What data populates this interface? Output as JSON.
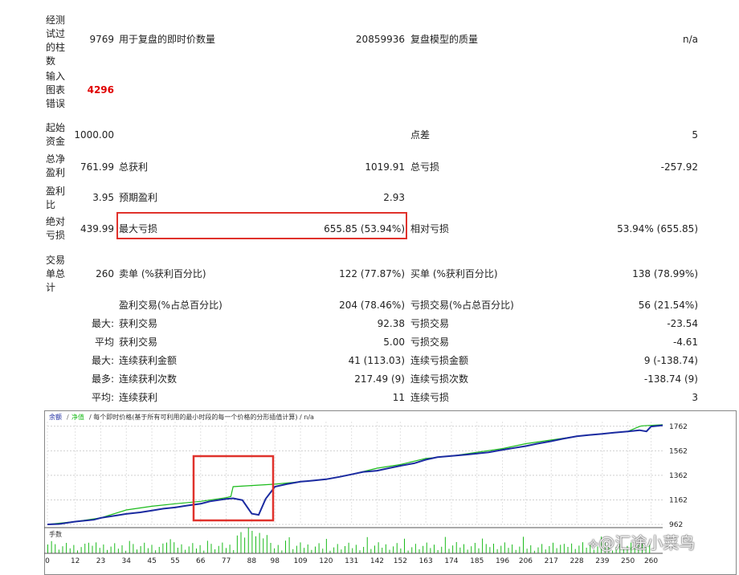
{
  "rows": [
    {
      "label": "经测试过的柱数",
      "v1": "9769",
      "l2": "用于复盘的即时价数量",
      "v2": "20859936",
      "l3": "复盘模型的质量",
      "v3": "n/a"
    },
    {
      "label": "输入图表错误",
      "v1": "4296"
    },
    {
      "label": "起始资金",
      "v1": "1000.00",
      "l3": "点差",
      "v3": "5"
    },
    {
      "label": "总净盈利",
      "v1": "761.99",
      "l2": "总获利",
      "v2": "1019.91",
      "l3": "总亏损",
      "v3": "-257.92"
    },
    {
      "label": "盈利比",
      "v1": "3.95",
      "l2": "预期盈利",
      "v2": "2.93"
    },
    {
      "label": "绝对亏损",
      "v1": "439.99",
      "l2": "最大亏损",
      "v2": "655.85 (53.94%)",
      "l3": "相对亏损",
      "v3": "53.94% (655.85)"
    },
    {
      "label": "交易单总计",
      "v1": "260",
      "l2": "卖单 (%获利百分比)",
      "v2": "122 (77.87%)",
      "l3": "买单 (%获利百分比)",
      "v3": "138 (78.99%)"
    }
  ],
  "sub_rows": [
    {
      "prefix": "",
      "l2": "盈利交易(%占总百分比)",
      "v2": "204 (78.46%)",
      "l3": "亏损交易(%占总百分比)",
      "v3": "56 (21.54%)"
    },
    {
      "prefix": "最大:",
      "l2": "获利交易",
      "v2": "92.38",
      "l3": "亏损交易",
      "v3": "-23.54"
    },
    {
      "prefix": "平均",
      "l2": "获利交易",
      "v2": "5.00",
      "l3": "亏损交易",
      "v3": "-4.61"
    },
    {
      "prefix": "最大:",
      "l2": "连续获利金额",
      "v2": "41 (113.03)",
      "l3": "连续亏损金额",
      "v3": "9 (-138.74)"
    },
    {
      "prefix": "最多:",
      "l2": "连续获利次数",
      "v2": "217.49 (9)",
      "l3": "连续亏损次数",
      "v3": "-138.74 (9)"
    },
    {
      "prefix": "平均:",
      "l2": "连续获利",
      "v2": "11",
      "l3": "连续亏损",
      "v3": "3"
    }
  ],
  "chart_data": {
    "type": "line",
    "legend": {
      "balance": "余额",
      "equity": "净值",
      "rest": "/ 每个即时价格(基于所有可利用的最小时段的每一个价格的分形插值计算) / n/a"
    },
    "y_ticks": [
      1762,
      1562,
      1362,
      1162,
      962
    ],
    "ylim": [
      962,
      1800
    ],
    "x_ticks": [
      0,
      12,
      23,
      34,
      45,
      55,
      66,
      77,
      88,
      98,
      109,
      120,
      131,
      142,
      152,
      163,
      174,
      185,
      196,
      206,
      217,
      228,
      239,
      250,
      260
    ],
    "xlim": [
      0,
      265
    ],
    "volume_label": "手数",
    "balance": {
      "name": "余额",
      "color": "#1a2aa0",
      "x": [
        0,
        5,
        12,
        20,
        23,
        30,
        34,
        40,
        45,
        50,
        55,
        60,
        66,
        70,
        77,
        80,
        84,
        88,
        91,
        94,
        98,
        103,
        109,
        115,
        120,
        126,
        131,
        136,
        142,
        147,
        152,
        158,
        163,
        168,
        174,
        180,
        185,
        190,
        196,
        201,
        206,
        211,
        217,
        222,
        228,
        233,
        239,
        244,
        250,
        255,
        258,
        260,
        265
      ],
      "y": [
        962,
        965,
        985,
        1000,
        1015,
        1035,
        1048,
        1060,
        1075,
        1090,
        1100,
        1115,
        1130,
        1150,
        1170,
        1175,
        1160,
        1050,
        1040,
        1170,
        1270,
        1290,
        1310,
        1320,
        1330,
        1350,
        1370,
        1390,
        1400,
        1420,
        1440,
        1460,
        1490,
        1510,
        1520,
        1530,
        1540,
        1550,
        1570,
        1585,
        1600,
        1620,
        1640,
        1660,
        1680,
        1690,
        1700,
        1710,
        1720,
        1730,
        1720,
        1760,
        1770
      ]
    },
    "equity": {
      "name": "净值",
      "color": "#1bbb1b",
      "x": [
        0,
        12,
        23,
        34,
        45,
        55,
        66,
        77,
        79,
        80,
        98,
        109,
        120,
        131,
        142,
        152,
        163,
        174,
        185,
        196,
        206,
        217,
        228,
        239,
        250,
        255,
        256,
        265
      ],
      "y": [
        962,
        985,
        1015,
        1080,
        1110,
        1130,
        1150,
        1180,
        1190,
        1270,
        1290,
        1310,
        1330,
        1370,
        1420,
        1450,
        1500,
        1520,
        1550,
        1580,
        1620,
        1650,
        1680,
        1700,
        1720,
        1760,
        1765,
        1775
      ]
    }
  },
  "watermark": "⟡@汇途小菜鸟"
}
